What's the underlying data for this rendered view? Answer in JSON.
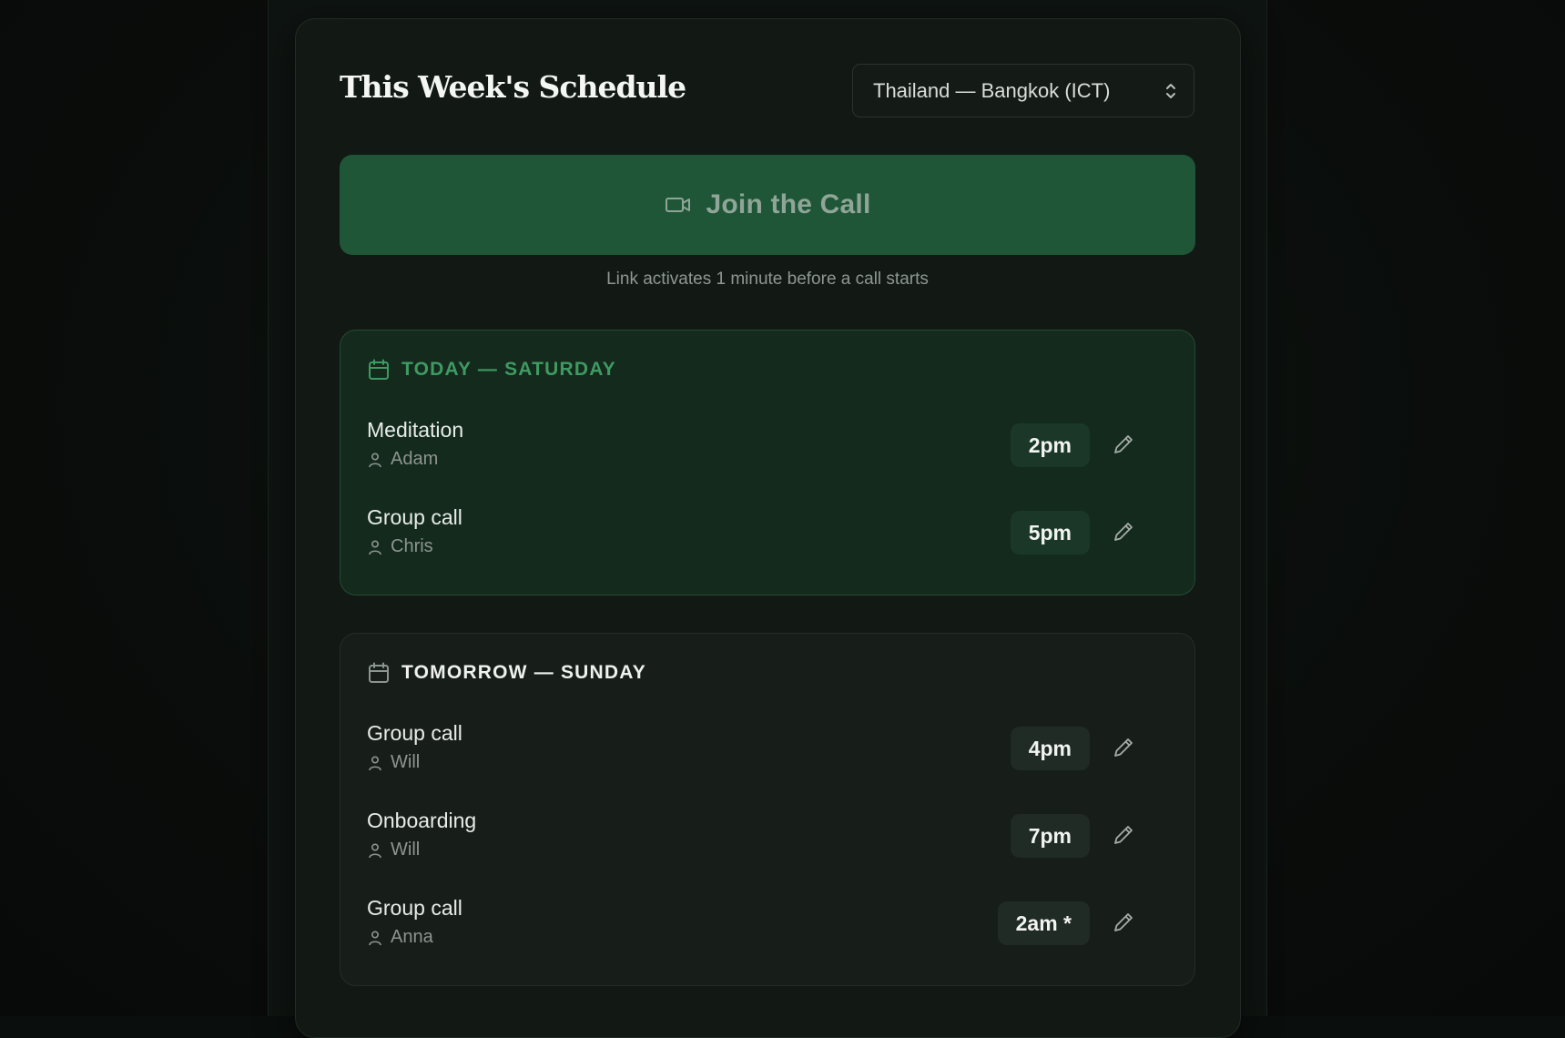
{
  "header": {
    "title": "This Week's Schedule",
    "timezone": {
      "selected": "Thailand — Bangkok (ICT)",
      "icon": "chevron-updown-icon"
    }
  },
  "join": {
    "label": "Join the Call",
    "icon": "video-camera-icon",
    "hint": "Link activates 1 minute before a call starts"
  },
  "days": [
    {
      "heading": "TODAY — SATURDAY",
      "icon": "calendar-icon",
      "accent": "#3f9a62",
      "events": [
        {
          "name": "Meditation",
          "person": "Adam",
          "time": "2pm"
        },
        {
          "name": "Group call",
          "person": "Chris",
          "time": "5pm"
        }
      ]
    },
    {
      "heading": "TOMORROW — SUNDAY",
      "icon": "calendar-icon",
      "events": [
        {
          "name": "Group call",
          "person": "Will",
          "time": "4pm"
        },
        {
          "name": "Onboarding",
          "person": "Will",
          "time": "7pm"
        },
        {
          "name": "Group call",
          "person": "Anna",
          "time": "2am *"
        }
      ]
    }
  ],
  "colors": {
    "brand_green": "#1f5637",
    "today_accent": "#3f9a62",
    "background": "#121915"
  }
}
